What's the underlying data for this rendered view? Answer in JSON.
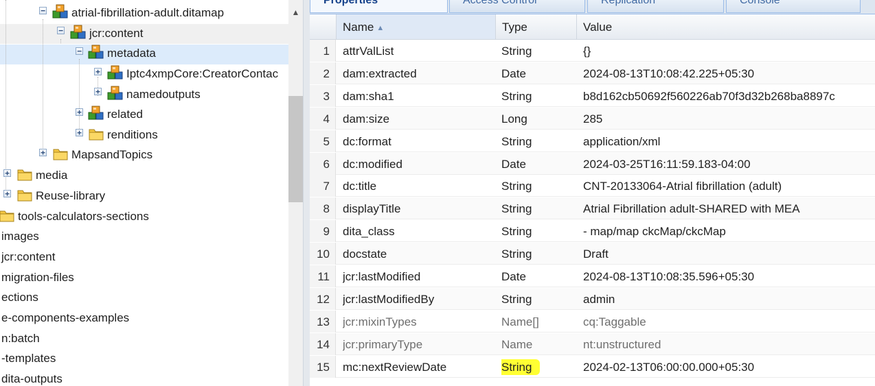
{
  "tree": {
    "nodes": [
      {
        "label": "atrial-fibrillation-adult.ditamap",
        "expander": "minus",
        "icon": "node-cube-icon"
      },
      {
        "label": "jcr:content",
        "expander": "minus",
        "icon": "node-cube-icon"
      },
      {
        "label": "metadata",
        "expander": "minus",
        "icon": "node-cube-icon"
      },
      {
        "label": "Iptc4xmpCore:CreatorContac",
        "expander": "plus",
        "icon": "node-cube-icon"
      },
      {
        "label": "namedoutputs",
        "expander": "plus",
        "icon": "node-cube-icon"
      },
      {
        "label": "related",
        "expander": "plus",
        "icon": "node-cube-icon"
      },
      {
        "label": "renditions",
        "expander": "plus",
        "icon": "folder-icon"
      },
      {
        "label": "MapsandTopics",
        "expander": "plus",
        "icon": "folder-icon"
      },
      {
        "label": "media",
        "expander": "plus",
        "icon": "folder-icon"
      },
      {
        "label": "Reuse-library",
        "expander": "plus",
        "icon": "folder-icon"
      },
      {
        "label": "tools-calculators-sections",
        "expander": "",
        "icon": "folder-icon"
      },
      {
        "label": "images",
        "expander": "",
        "icon": ""
      },
      {
        "label": "jcr:content",
        "expander": "",
        "icon": ""
      },
      {
        "label": "migration-files",
        "expander": "",
        "icon": ""
      },
      {
        "label": "ections",
        "expander": "",
        "icon": ""
      },
      {
        "label": "e-components-examples",
        "expander": "",
        "icon": ""
      },
      {
        "label": "n:batch",
        "expander": "",
        "icon": ""
      },
      {
        "label": "-templates",
        "expander": "",
        "icon": ""
      },
      {
        "label": "dita-outputs",
        "expander": "",
        "icon": ""
      }
    ]
  },
  "tabs": [
    {
      "label": "Properties",
      "active": true
    },
    {
      "label": "Access Control",
      "active": false
    },
    {
      "label": "Replication",
      "active": false
    },
    {
      "label": "Console",
      "active": false
    }
  ],
  "grid": {
    "columns": {
      "name": "Name",
      "type": "Type",
      "value": "Value"
    },
    "sorted_column": "name",
    "rows": [
      {
        "num": "1",
        "name": "attrValList",
        "type": "String",
        "value": "{}"
      },
      {
        "num": "2",
        "name": "dam:extracted",
        "type": "Date",
        "value": "2024-08-13T10:08:42.225+05:30"
      },
      {
        "num": "3",
        "name": "dam:sha1",
        "type": "String",
        "value": "b8d162cb50692f560226ab70f3d32b268ba8897c"
      },
      {
        "num": "4",
        "name": "dam:size",
        "type": "Long",
        "value": "285"
      },
      {
        "num": "5",
        "name": "dc:format",
        "type": "String",
        "value": "application/xml"
      },
      {
        "num": "6",
        "name": "dc:modified",
        "type": "Date",
        "value": "2024-03-25T16:11:59.183-04:00"
      },
      {
        "num": "7",
        "name": "dc:title",
        "type": "String",
        "value": "CNT-20133064-Atrial fibrillation (adult)"
      },
      {
        "num": "8",
        "name": "displayTitle",
        "type": "String",
        "value": "Atrial Fibrillation adult-SHARED with MEA"
      },
      {
        "num": "9",
        "name": "dita_class",
        "type": "String",
        "value": "- map/map ckcMap/ckcMap"
      },
      {
        "num": "10",
        "name": "docstate",
        "type": "String",
        "value": "Draft"
      },
      {
        "num": "11",
        "name": "jcr:lastModified",
        "type": "Date",
        "value": "2024-08-13T10:08:35.596+05:30"
      },
      {
        "num": "12",
        "name": "jcr:lastModifiedBy",
        "type": "String",
        "value": "admin"
      },
      {
        "num": "13",
        "name": "jcr:mixinTypes",
        "type": "Name[]",
        "value": "cq:Taggable",
        "muted": true
      },
      {
        "num": "14",
        "name": "jcr:primaryType",
        "type": "Name",
        "value": "nt:unstructured",
        "muted": true
      },
      {
        "num": "15",
        "name": "mc:nextReviewDate",
        "type": "String",
        "value": "2024-02-13T06:00:00.000+05:30",
        "highlight_type": true
      }
    ]
  },
  "colors": {
    "highlight": "#ffff33",
    "selected_row": "#dcebfb",
    "tab_text": "#15428b"
  }
}
